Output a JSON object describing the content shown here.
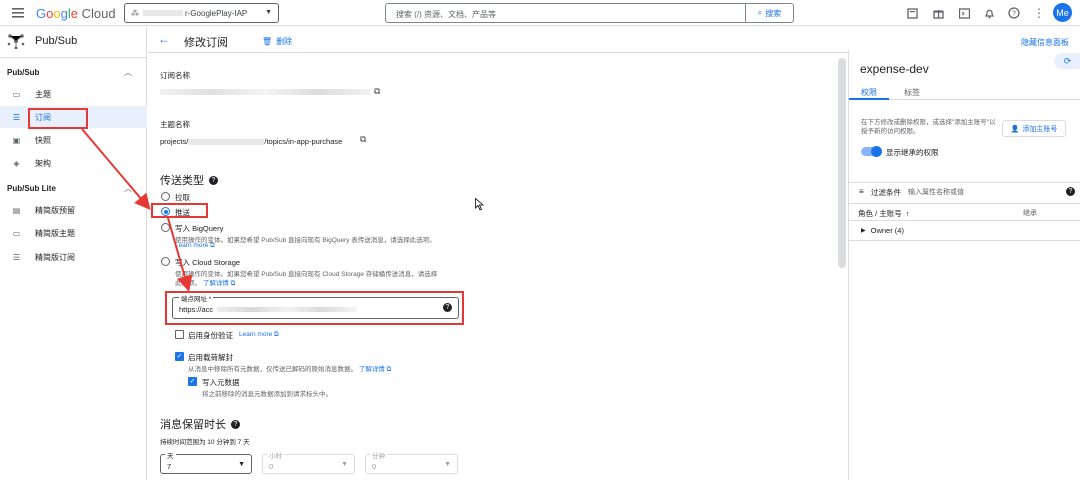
{
  "topbar": {
    "logo": "Google Cloud",
    "project": "r-GooglePlay-IAP",
    "search_placeholder": "搜索 (/) 资源、文档、产品等",
    "search_button": "搜索",
    "avatar": "Me"
  },
  "sidebar": {
    "product": "Pub/Sub",
    "section1": "Pub/Sub",
    "items1": [
      {
        "label": "主题",
        "icon": "chat-icon"
      },
      {
        "label": "订阅",
        "icon": "list-icon"
      },
      {
        "label": "快照",
        "icon": "snapshot-icon"
      },
      {
        "label": "架构",
        "icon": "schema-icon"
      }
    ],
    "section2": "Pub/Sub Lite",
    "items2": [
      {
        "label": "精简版预留",
        "icon": "reservation-icon"
      },
      {
        "label": "精简版主题",
        "icon": "chat-icon"
      },
      {
        "label": "精简版订阅",
        "icon": "list-icon"
      }
    ]
  },
  "header": {
    "title": "修改订阅",
    "delete": "删除",
    "hide_panel": "隐藏信息面板"
  },
  "form": {
    "sub_name_label": "订阅名称",
    "topic_label": "主题名称",
    "topic_prefix": "projects/",
    "topic_suffix": "/topics/in-app-purchase",
    "delivery_title": "传送类型",
    "opt_pull": "拉取",
    "opt_push": "推送",
    "opt_bq": "写入 BigQuery",
    "opt_bq_desc": "使用操作的变体。如果您希望 Pub/Sub 直接向现有 BigQuery 表传送消息，请选择此选项。",
    "opt_bq_link": "Learn more",
    "opt_gcs": "写入 Cloud Storage",
    "opt_gcs_desc1": "使用操作的变体。如果您希望 Pub/Sub 直接向现有 Cloud Storage 存储桶传送消息，请选择",
    "opt_gcs_desc2": "此选项。",
    "opt_gcs_link": "了解详情",
    "endpoint_label": "端点网址 *",
    "endpoint_value": "https://acc",
    "auth_label": "启用身份验证",
    "auth_link": "Learn more",
    "unwrap_label": "启用载荷解封",
    "unwrap_desc": "从消息中移除所有元数据，仅传送已解码的原始消息数据。",
    "unwrap_link": "了解详情",
    "metadata_label": "写入元数据",
    "metadata_desc": "将之前移除的消息元数据添加到请求标头中。",
    "retention_title": "消息保留时长",
    "retention_hint": "持续时间范围为 10 分钟到 7 天",
    "days_label": "天",
    "days_value": "7",
    "hours_label": "小时",
    "hours_value": "0",
    "minutes_label": "分钟",
    "minutes_value": "0"
  },
  "panel": {
    "title": "expense-dev",
    "tab_perm": "权限",
    "tab_labels": "标签",
    "desc": "在下方修改或删除权限，或选择\"添加主账号\"以授予新的访问权限。",
    "add_btn": "添加主账号",
    "inherit": "显示继承的权限",
    "filter_label": "过滤条件",
    "filter_placeholder": "输入属性名称或值",
    "col_role": "角色 / 主账号",
    "col_inherit": "继承",
    "owner_row": "Owner (4)"
  },
  "colors": {
    "accent": "#1a73e8",
    "annotation": "#e53935"
  }
}
